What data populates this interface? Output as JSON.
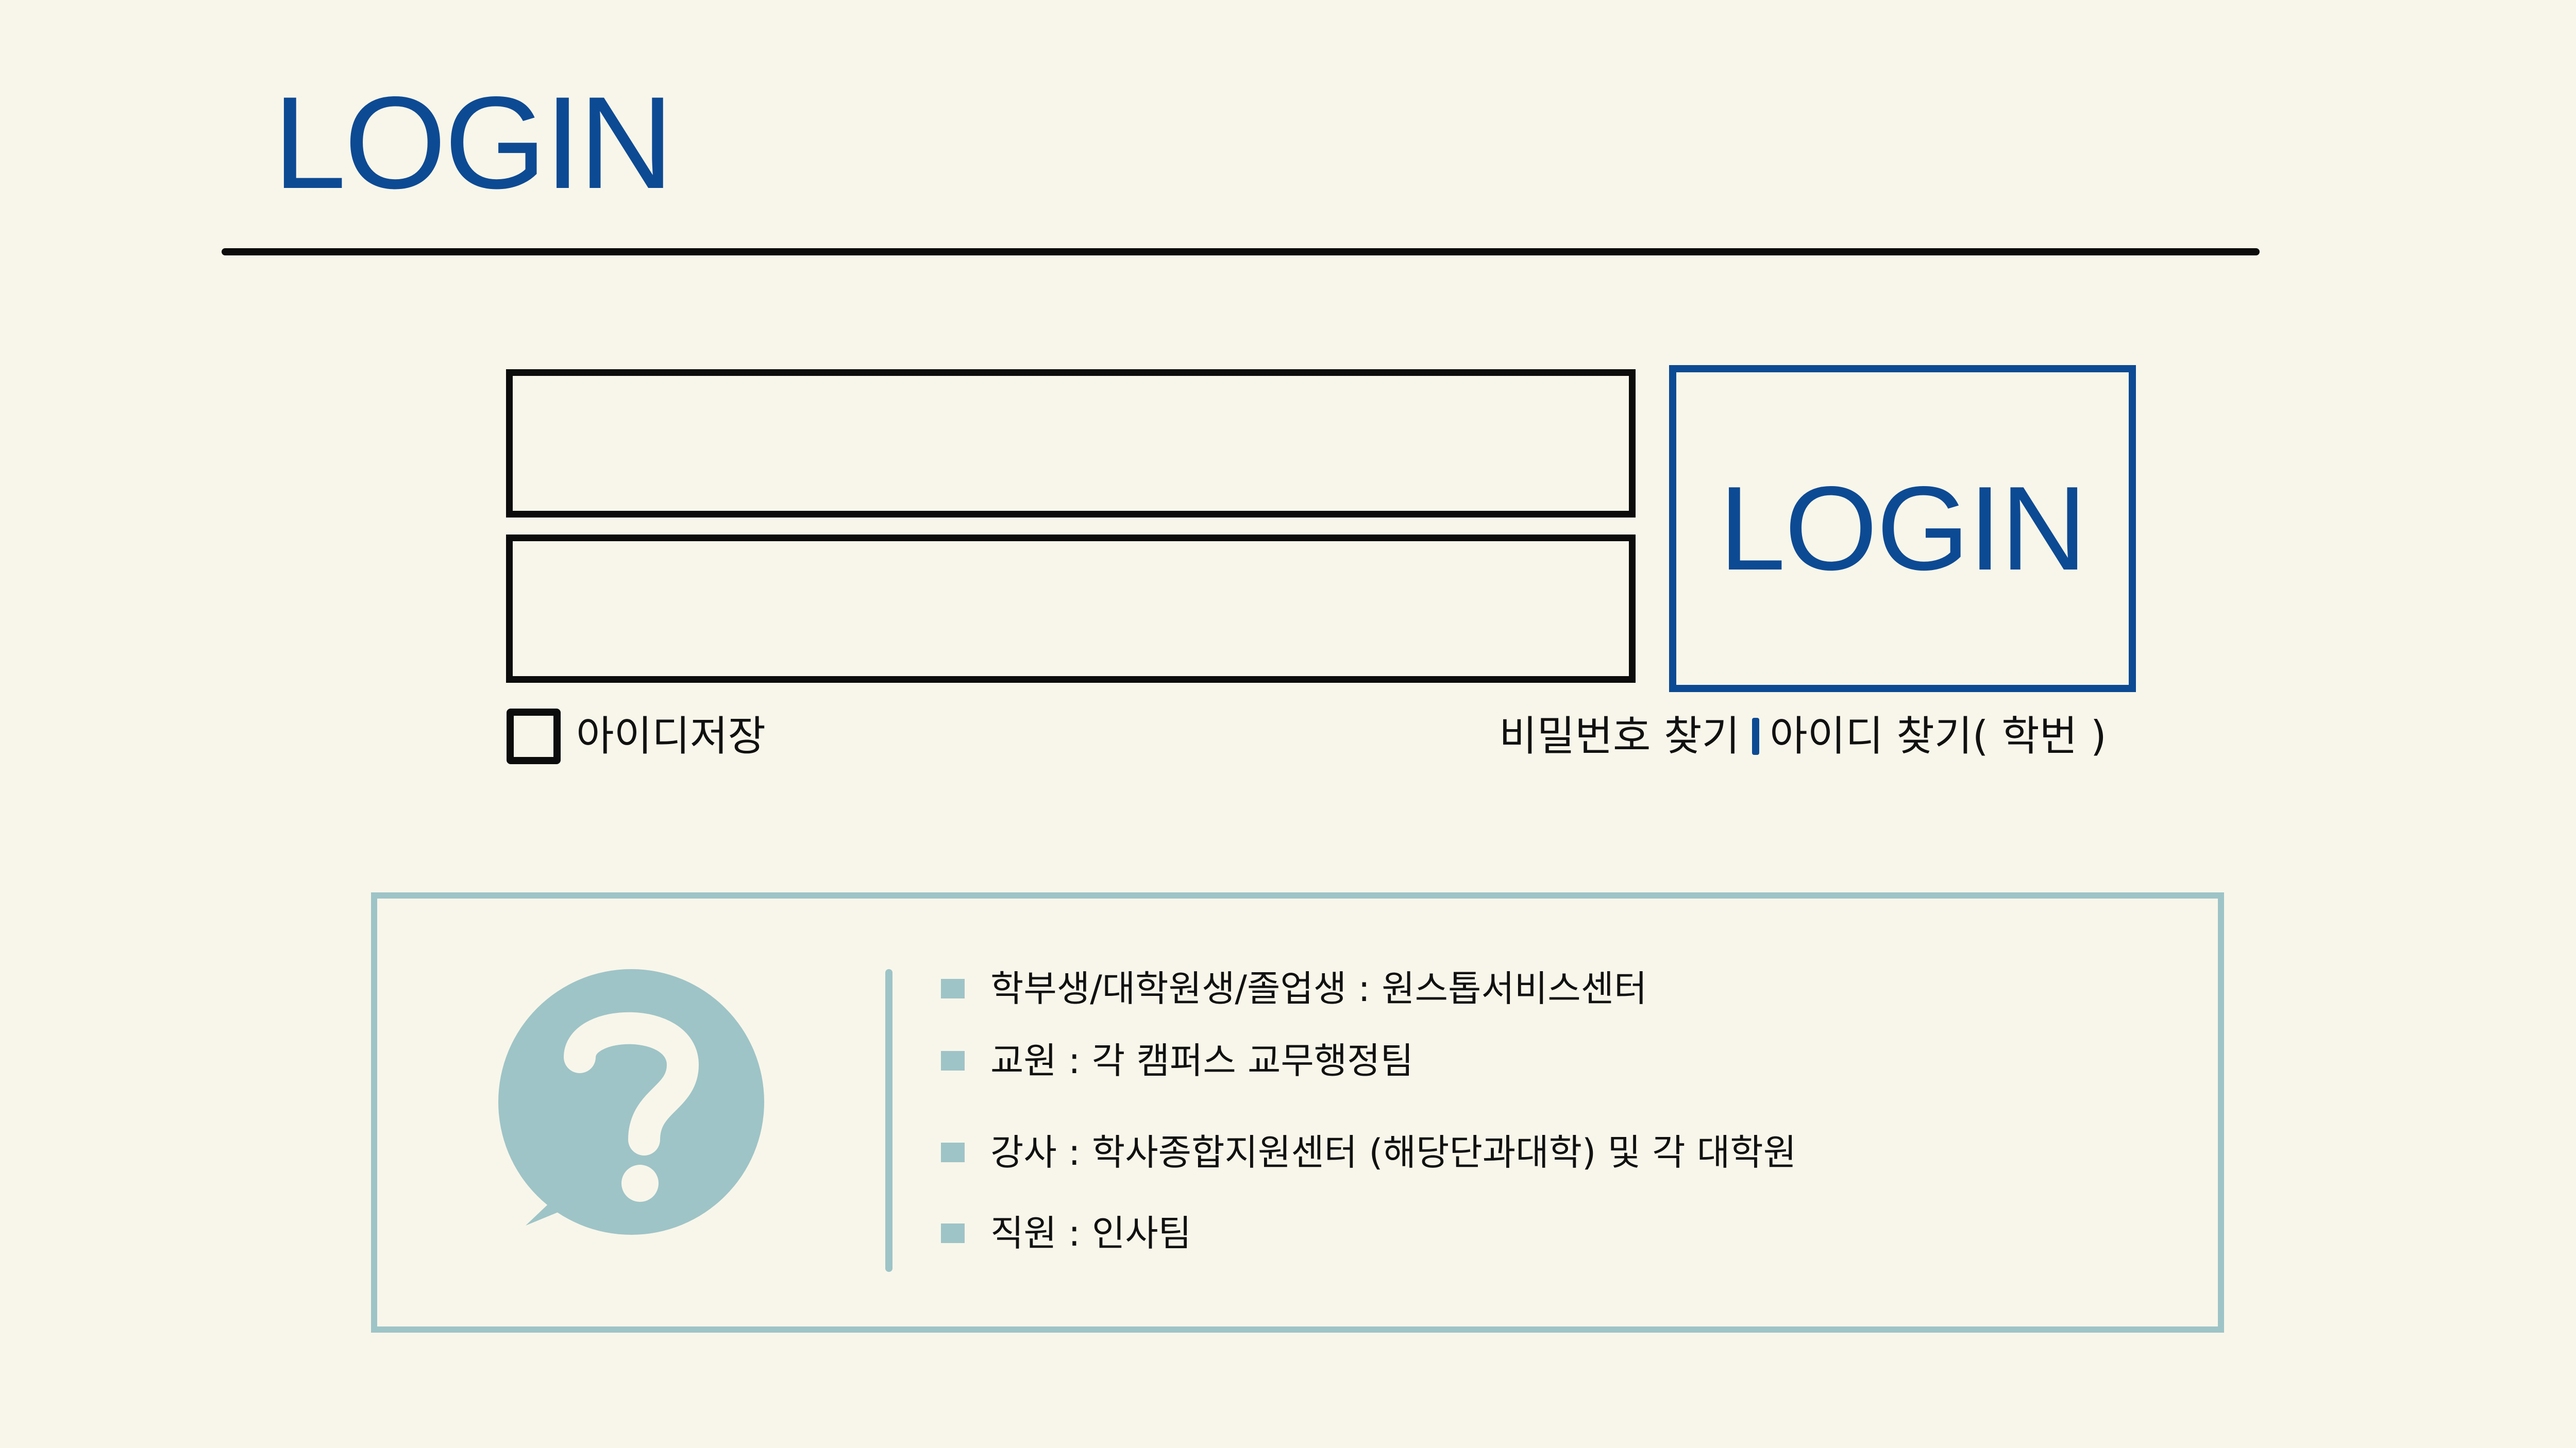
{
  "header": {
    "title": "LOGIN"
  },
  "login_form": {
    "id_field": {
      "value": "",
      "placeholder": ""
    },
    "password_field": {
      "value": "",
      "placeholder": ""
    },
    "login_button_label": "LOGIN",
    "remember_id_label": "아이디저장",
    "remember_id_checked": false,
    "find_password_label": "비밀번호 찾기",
    "find_id_label": "아이디 찾기( 학번 )"
  },
  "help": {
    "icon": "question-speech-bubble-icon",
    "items": [
      {
        "text": "학부생/대학원생/졸업생 : 원스톱서비스센터"
      },
      {
        "text": "교원 : 각 캠퍼스 교무행정팀"
      },
      {
        "text": "강사 : 학사종합지원센터 (해당단과대학) 및 각 대학원"
      },
      {
        "text": "직원 : 인사팀"
      }
    ]
  },
  "colors": {
    "background": "#f8f6ea",
    "brand_blue": "#0d4a94",
    "accent_teal": "#9ec4c7",
    "border_black": "#0c0c0c"
  }
}
